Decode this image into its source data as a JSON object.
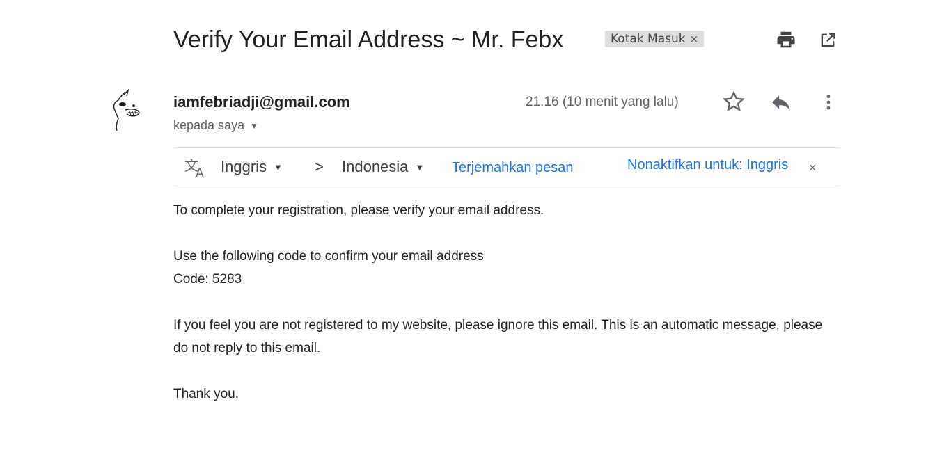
{
  "email": {
    "subject": "Verify Your Email Address ~ Mr. Febx",
    "label": "Kotak Masuk",
    "label_close": "×",
    "sender": "iamfebriadji@gmail.com",
    "recipient": "kepada saya",
    "timestamp": "21.16 (10 menit yang lalu)"
  },
  "translate_bar": {
    "from_language": "Inggris",
    "separator": ">",
    "to_language": "Indonesia",
    "translate_link": "Terjemahkan pesan",
    "disable_link": "Nonaktifkan untuk: Inggris",
    "close": "×"
  },
  "body": {
    "line1": "To complete your registration, please verify your email address.",
    "line2": "Use the following code to confirm your email address",
    "line3": "Code: 5283",
    "line4": "If you feel you are not registered to my website, please ignore this email. This is an automatic message, please do not reply to this email.",
    "line5": "Thank you."
  },
  "icons": {
    "print": "print-icon",
    "open_new_window": "open-in-new-window-icon",
    "star": "star-icon",
    "reply": "reply-icon",
    "more": "more-vertical-icon",
    "translate": "translate-icon"
  },
  "colors": {
    "link": "#1a73e8",
    "label_chip_bg": "#dddddd",
    "secondary_text": "#5f6368"
  }
}
